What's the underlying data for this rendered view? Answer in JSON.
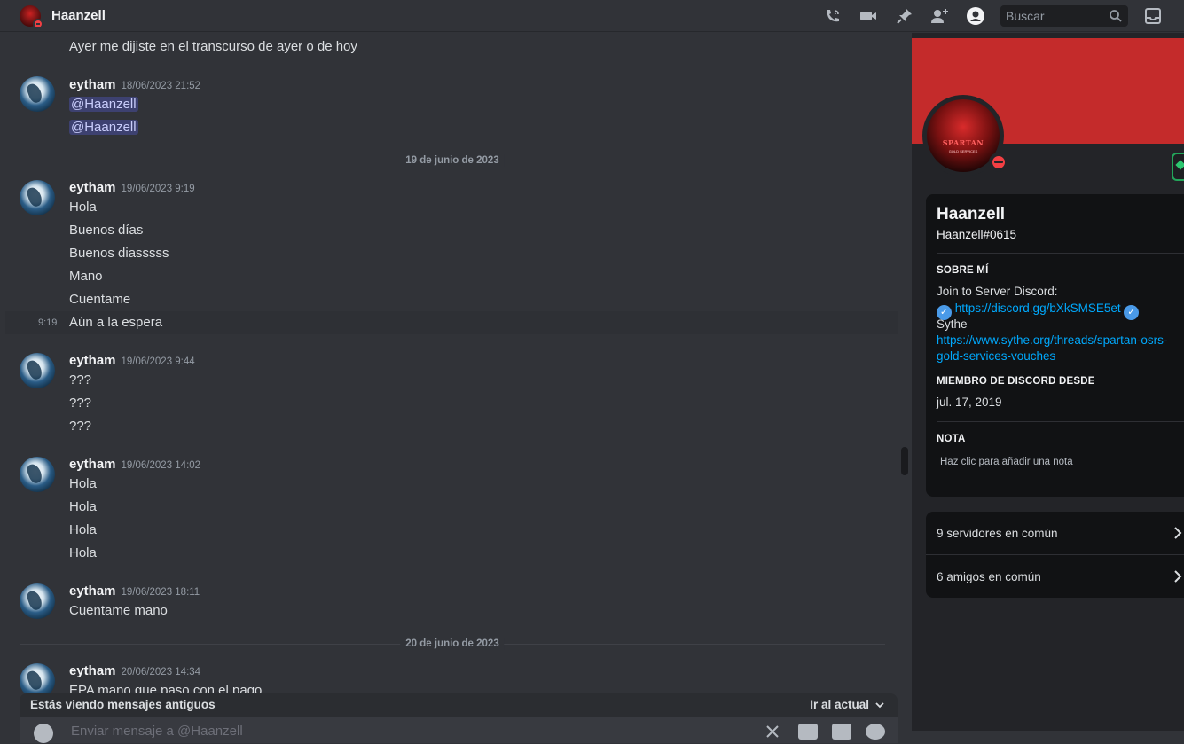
{
  "header": {
    "title": "Haanzell",
    "search_placeholder": "Buscar",
    "icons": [
      "call-icon",
      "video-icon",
      "pin-icon",
      "add-member-icon",
      "profile-toggle-icon",
      "search-icon",
      "inbox-icon"
    ]
  },
  "messages": {
    "m0": "Ayer me dijiste en el transcurso de ayer o de hoy",
    "g1": {
      "author": "eytham",
      "ts": "18/06/2023 21:52",
      "l1": "@Haanzell",
      "l2": "@Haanzell"
    },
    "d1": "19 de junio de 2023",
    "g2": {
      "author": "eytham",
      "ts": "19/06/2023 9:19",
      "l1": "Hola",
      "l2": "Buenos días",
      "l3": "Buenos diasssss",
      "l4": "Mano",
      "l5": "Cuentame",
      "l6": "Aún a la espera",
      "l6_ts": "9:19"
    },
    "g3": {
      "author": "eytham",
      "ts": "19/06/2023 9:44",
      "l1": "???",
      "l2": "???",
      "l3": "???"
    },
    "g4": {
      "author": "eytham",
      "ts": "19/06/2023 14:02",
      "l1": "Hola",
      "l2": "Hola",
      "l3": "Hola",
      "l4": "Hola"
    },
    "g5": {
      "author": "eytham",
      "ts": "19/06/2023 18:11",
      "l1": "Cuentame mano"
    },
    "d2": "20 de junio de 2023",
    "g6": {
      "author": "eytham",
      "ts": "20/06/2023 14:34",
      "l1": "EPA mano que paso con el pago"
    }
  },
  "oldbar": {
    "label": "Estás viendo mensajes antiguos",
    "jump": "Ir al actual"
  },
  "composer": {
    "placeholder": "Enviar mensaje a @Haanzell"
  },
  "profile": {
    "name": "Haanzell",
    "tag": "Haanzell#0615",
    "status": "dnd",
    "avatar_text": "SPARTAN",
    "avatar_subtext": "GOLD SERVICES",
    "about_heading": "SOBRE MÍ",
    "about_line1": "Join to Server Discord:",
    "about_link1": "https://discord.gg/bXkSMSE5et",
    "about_line3": "Sythe",
    "about_link2a": "https://www.sythe.org/threads/spartan-osrs-",
    "about_link2b": "gold-services-vouches",
    "member_heading": "MIEMBRO DE DISCORD DESDE",
    "member_since": "jul. 17, 2019",
    "note_heading": "NOTA",
    "note_placeholder": "Haz clic para añadir una nota",
    "mutual_servers": "9 servidores en común",
    "mutual_friends": "6 amigos en común"
  },
  "colors": {
    "background": "#313338",
    "panel": "#232428",
    "banner": "#c42b2b",
    "link": "#00a8fc",
    "dnd": "#f23f43",
    "mention_bg": "#3c4270"
  }
}
